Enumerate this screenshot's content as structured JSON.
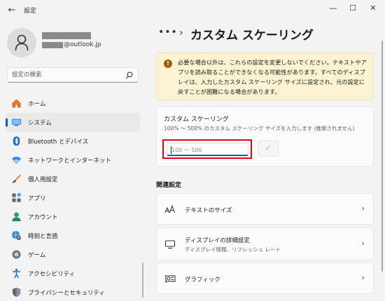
{
  "window": {
    "app_title": "設定",
    "back_glyph": "←",
    "minimize_glyph": "—",
    "maximize_glyph": "☐",
    "close_glyph": "✕"
  },
  "user": {
    "email_suffix": "@outlook.jp"
  },
  "search": {
    "placeholder": "設定の検索"
  },
  "sidebar": {
    "items": [
      {
        "label": "ホーム",
        "icon": "home-icon"
      },
      {
        "label": "システム",
        "icon": "system-icon",
        "active": true
      },
      {
        "label": "Bluetooth とデバイス",
        "icon": "bluetooth-icon"
      },
      {
        "label": "ネットワークとインターネット",
        "icon": "wifi-icon"
      },
      {
        "label": "個人用設定",
        "icon": "brush-icon"
      },
      {
        "label": "アプリ",
        "icon": "apps-icon"
      },
      {
        "label": "アカウント",
        "icon": "account-icon"
      },
      {
        "label": "時刻と言語",
        "icon": "globe-clock-icon"
      },
      {
        "label": "ゲーム",
        "icon": "game-icon"
      },
      {
        "label": "アクセシビリティ",
        "icon": "accessibility-icon"
      },
      {
        "label": "プライバシーとセキュリティ",
        "icon": "shield-icon"
      }
    ]
  },
  "breadcrumb": {
    "more": "•••",
    "separator": "›",
    "title": "カスタム スケーリング"
  },
  "warning": {
    "icon_glyph": "!",
    "text": "必要な場合以外は、これらの設定を変更しないでください。テキストやアプリを読み取ることができなくなる可能性があります。すべてのディスプレイは、入力したカスタム スケーリング サイズに設定され、元の設定に戻すことが困難になる場合があります。"
  },
  "custom_scaling": {
    "title": "カスタム スケーリング",
    "description": "100% 〜 500% のカスタム スケーリング サイズを入力します (推奨されません)",
    "placeholder": "100 〜 500",
    "value": "",
    "apply_glyph": "✓"
  },
  "related": {
    "heading": "関連設定",
    "items": [
      {
        "title": "テキストのサイズ",
        "subtitle": "",
        "icon": "text-size-icon"
      },
      {
        "title": "ディスプレイの詳細設定",
        "subtitle": "ディスプレイ情報、リフレッシュ レート",
        "icon": "monitor-icon"
      },
      {
        "title": "グラフィック",
        "subtitle": "",
        "icon": "graphics-card-icon"
      }
    ],
    "chevron": "›"
  },
  "colors": {
    "accent": "#005fb8",
    "highlight_border": "#e0001b",
    "warning_bg": "#fcf3d3",
    "warning_icon": "#9d5d00"
  }
}
